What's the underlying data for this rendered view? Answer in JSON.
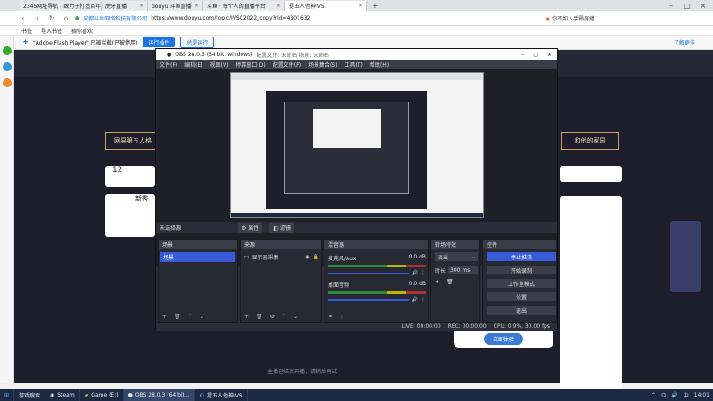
{
  "browser": {
    "tabs": [
      {
        "title": "2345网址导航 - 致力于打造百年品牌",
        "active": false
      },
      {
        "title": "虎牙直播",
        "active": false
      },
      {
        "title": "douyu 斗鱼直播",
        "active": false
      },
      {
        "title": "斗鱼 · 每个人的直播平台",
        "active": false
      },
      {
        "title": "提五人他神IVS",
        "active": true
      }
    ],
    "url_site": "成都斗鱼网络科技有限公司",
    "url": "https://www.douyu.com/topic/IVSC2022_copy?rid=4801632",
    "search_hint": "你不如入手霸屏播",
    "bookmarks": [
      "书签",
      "导入书签",
      "猜你喜欢"
    ],
    "flash_msg": "\"Adobe Flash Player\" 已被拦截(已被停用)",
    "flash_btn1": "运行插件",
    "flash_btn2": "总是运行",
    "flash_right": "了解更多"
  },
  "page": {
    "banner_left": "网易第五人格",
    "banner_right": "和他的家园",
    "count_label": "12",
    "side_label": "新秀",
    "bottom_caption": "主播已结束开播，请稍后再试",
    "try_btn": "立即体验"
  },
  "obs": {
    "title": "OBS 28.0.3 (64 bit, windows)",
    "title_sub": "配置文件: 未命名    场景: 未命名",
    "menus": [
      "文件(F)",
      "编辑(E)",
      "视图(V)",
      "停靠窗口(D)",
      "配置文件(P)",
      "场景集合(S)",
      "工具(T)",
      "帮助(H)"
    ],
    "no_source": "未选择源",
    "btn_props": "属性",
    "btn_filters": "滤镜",
    "docks": {
      "scenes": {
        "title": "场景",
        "items": [
          "场景"
        ]
      },
      "sources": {
        "title": "来源",
        "items": [
          "显示器采集"
        ]
      },
      "mixer": {
        "title": "混音器",
        "channels": [
          {
            "name": "麦克风/Aux",
            "db": "0.0 dB"
          },
          {
            "name": "桌面音频",
            "db": "0.0 dB"
          }
        ]
      },
      "transitions": {
        "title": "转场特效",
        "type": "淡出",
        "duration_label": "时长",
        "duration": "300 ms"
      },
      "controls": {
        "title": "控件",
        "buttons": [
          "停止推流",
          "开始录制",
          "工作室模式",
          "设置",
          "退出"
        ]
      }
    },
    "status": {
      "live": "LIVE: 00:00:00",
      "rec": "REC: 00:00:00",
      "cpu": "CPU: 0.9%, 30.00 fps"
    }
  },
  "taskbar": {
    "items": [
      {
        "label": "游戏搜索",
        "active": false
      },
      {
        "label": "Steam",
        "active": false
      },
      {
        "label": "Game (E:)",
        "active": false
      },
      {
        "label": "OBS 28.0.3 (64 bit...",
        "active": true
      },
      {
        "label": "提五人他神IVS",
        "active": false
      }
    ],
    "ime": "中",
    "time": "14:01"
  },
  "colors": {
    "obs_bg": "#2b2e38",
    "obs_accent": "#3a5bd9",
    "taskbar": "#1b2a42"
  }
}
